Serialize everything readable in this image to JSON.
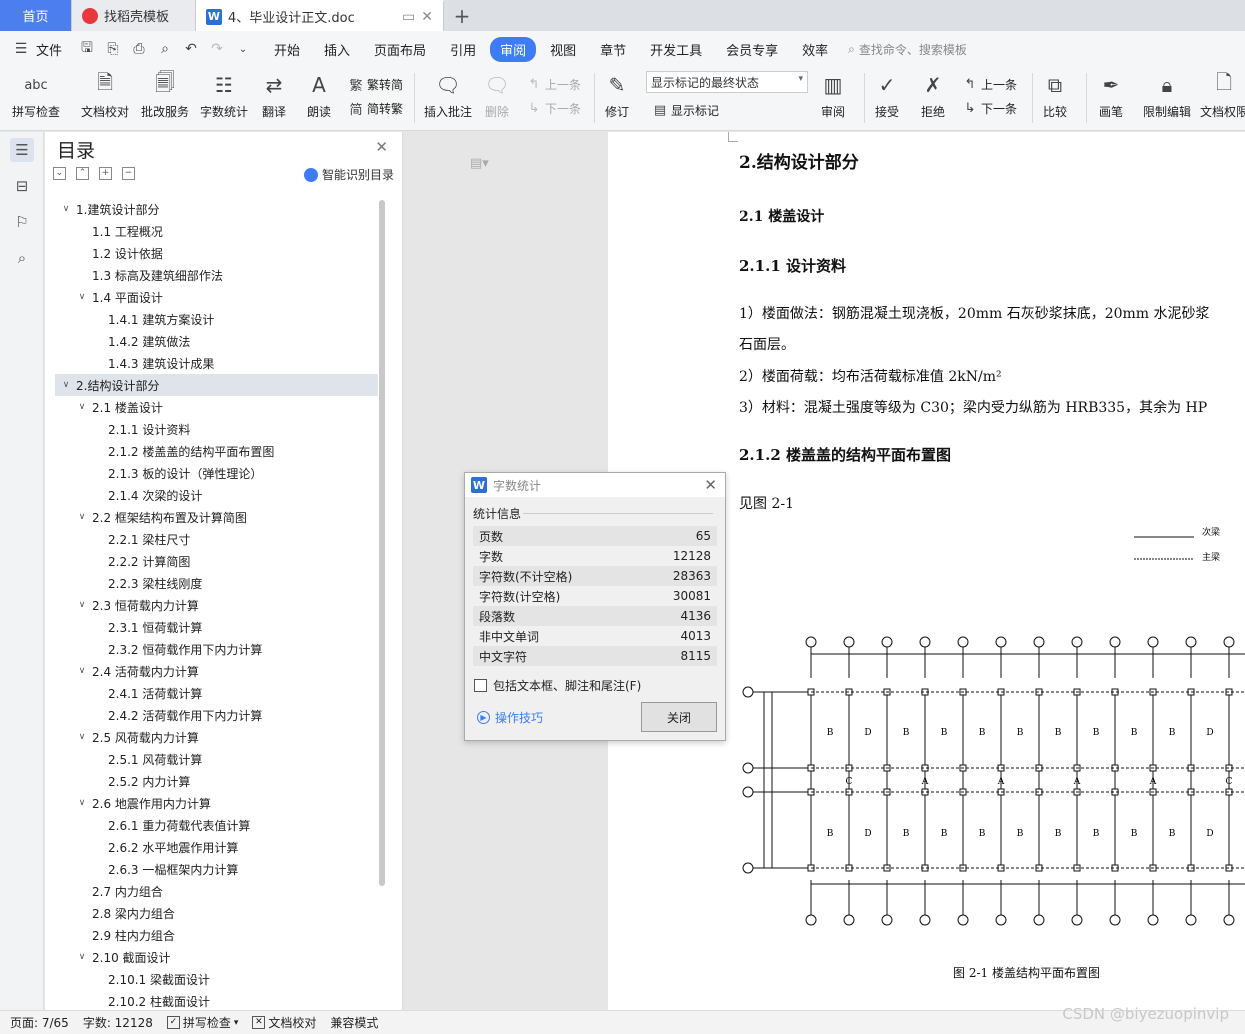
{
  "tabs": {
    "home": "首页",
    "template": "找稻壳模板",
    "doc": "4、毕业设计正文.doc"
  },
  "menu": {
    "file": "文件",
    "items": [
      "开始",
      "插入",
      "页面布局",
      "引用",
      "审阅",
      "视图",
      "章节",
      "开发工具",
      "会员专享",
      "效率"
    ],
    "search": "查找命令、搜索模板"
  },
  "ribbon": {
    "spell": "拼写检查",
    "proof": "文档校对",
    "batch": "批改服务",
    "wordcount": "字数统计",
    "translate": "翻译",
    "read": "朗读",
    "trad": "繁转简",
    "simp": "简转繁",
    "comment": "插入批注",
    "delete": "删除",
    "prev_c": "上一条",
    "next_c": "下一条",
    "revise": "修订",
    "markup_state": "显示标记的最终状态",
    "show_markup": "显示标记",
    "review": "审阅",
    "accept": "接受",
    "reject": "拒绝",
    "prev": "上一条",
    "next": "下一条",
    "compare": "比较",
    "pen": "画笔",
    "restrict": "限制编辑",
    "perm": "文档权限"
  },
  "toc": {
    "title": "目录",
    "smart": "智能识别目录",
    "items": [
      {
        "t": "1.建筑设计部分",
        "lvl": 1,
        "ch": "v"
      },
      {
        "t": "1.1 工程概况",
        "lvl": 2,
        "ch": ""
      },
      {
        "t": "1.2 设计依据",
        "lvl": 2,
        "ch": ""
      },
      {
        "t": "1.3 标高及建筑细部作法",
        "lvl": 2,
        "ch": ""
      },
      {
        "t": "1.4 平面设计",
        "lvl": 2,
        "ch": "v"
      },
      {
        "t": "1.4.1 建筑方案设计",
        "lvl": 3,
        "ch": ""
      },
      {
        "t": "1.4.2 建筑做法",
        "lvl": 3,
        "ch": ""
      },
      {
        "t": "1.4.3  建筑设计成果",
        "lvl": 3,
        "ch": ""
      },
      {
        "t": "2.结构设计部分",
        "lvl": 1,
        "ch": "v",
        "sel": true
      },
      {
        "t": "2.1 楼盖设计",
        "lvl": 2,
        "ch": "v"
      },
      {
        "t": "2.1.1 设计资料",
        "lvl": 3,
        "ch": ""
      },
      {
        "t": "2.1.2 楼盖盖的结构平面布置图",
        "lvl": 3,
        "ch": ""
      },
      {
        "t": "2.1.3 板的设计（弹性理论）",
        "lvl": 3,
        "ch": ""
      },
      {
        "t": "2.1.4 次梁的设计",
        "lvl": 3,
        "ch": ""
      },
      {
        "t": "2.2 框架结构布置及计算简图",
        "lvl": 2,
        "ch": "v"
      },
      {
        "t": "2.2.1 梁柱尺寸",
        "lvl": 3,
        "ch": ""
      },
      {
        "t": "2.2.2 计算简图",
        "lvl": 3,
        "ch": ""
      },
      {
        "t": "2.2.3 梁柱线刚度",
        "lvl": 3,
        "ch": ""
      },
      {
        "t": "2.3 恒荷载内力计算",
        "lvl": 2,
        "ch": "v"
      },
      {
        "t": "2.3.1 恒荷载计算",
        "lvl": 3,
        "ch": ""
      },
      {
        "t": "2.3.2 恒荷载作用下内力计算",
        "lvl": 3,
        "ch": ""
      },
      {
        "t": "2.4 活荷载内力计算",
        "lvl": 2,
        "ch": "v"
      },
      {
        "t": "2.4.1 活荷载计算",
        "lvl": 3,
        "ch": ""
      },
      {
        "t": "2.4.2 活荷载作用下内力计算",
        "lvl": 3,
        "ch": ""
      },
      {
        "t": "2.5 风荷载内力计算",
        "lvl": 2,
        "ch": "v"
      },
      {
        "t": "2.5.1 风荷载计算",
        "lvl": 3,
        "ch": ""
      },
      {
        "t": "2.5.2 内力计算",
        "lvl": 3,
        "ch": ""
      },
      {
        "t": "2.6 地震作用内力计算",
        "lvl": 2,
        "ch": "v"
      },
      {
        "t": "2.6.1 重力荷载代表值计算",
        "lvl": 3,
        "ch": ""
      },
      {
        "t": "2.6.2 水平地震作用计算",
        "lvl": 3,
        "ch": ""
      },
      {
        "t": "2.6.3 一榀框架内力计算",
        "lvl": 3,
        "ch": ""
      },
      {
        "t": "2.7 内力组合",
        "lvl": 2,
        "ch": ""
      },
      {
        "t": "2.8 梁内力组合",
        "lvl": 2,
        "ch": ""
      },
      {
        "t": "2.9  柱内力组合",
        "lvl": 2,
        "ch": ""
      },
      {
        "t": "2.10 截面设计",
        "lvl": 2,
        "ch": "v"
      },
      {
        "t": "2.10.1 梁截面设计",
        "lvl": 3,
        "ch": ""
      },
      {
        "t": "2.10.2 柱截面设计",
        "lvl": 3,
        "ch": ""
      }
    ]
  },
  "doc": {
    "h1": "2.结构设计部分",
    "h2a": "2.1 楼盖设计",
    "h2b": "2.1.1 设计资料",
    "p1": "1）楼面做法：钢筋混凝土现浇板，20mm 石灰砂浆抹底，20mm 水泥砂浆",
    "p1b": "石面层。",
    "p2": "2）楼面荷载：均布活荷载标准值 2kN/m²",
    "p3": "3）材料：混凝土强度等级为 C30；梁内受力纵筋为 HRB335，其余为 HP",
    "h2c": "2.1.2 楼盖盖的结构平面布置图",
    "p4": "见图 2-1",
    "legend1": "次梁",
    "legend2": "主梁",
    "caption": "图 2-1  楼盖结构平面布置图"
  },
  "dialog": {
    "title": "字数统计",
    "section": "统计信息",
    "rows": [
      [
        "页数",
        "65"
      ],
      [
        "字数",
        "12128"
      ],
      [
        "字符数(不计空格)",
        "28363"
      ],
      [
        "字符数(计空格)",
        "30081"
      ],
      [
        "段落数",
        "4136"
      ],
      [
        "非中文单词",
        "4013"
      ],
      [
        "中文字符",
        "8115"
      ]
    ],
    "checkbox": "包括文本框、脚注和尾注(F)",
    "tip": "操作技巧",
    "close": "关闭"
  },
  "status": {
    "page": "页面: 7/65",
    "words": "字数: 12128",
    "spell": "拼写检查",
    "proof": "文档校对",
    "compat": "兼容模式"
  },
  "watermark": "CSDN @biyezuopinvip"
}
